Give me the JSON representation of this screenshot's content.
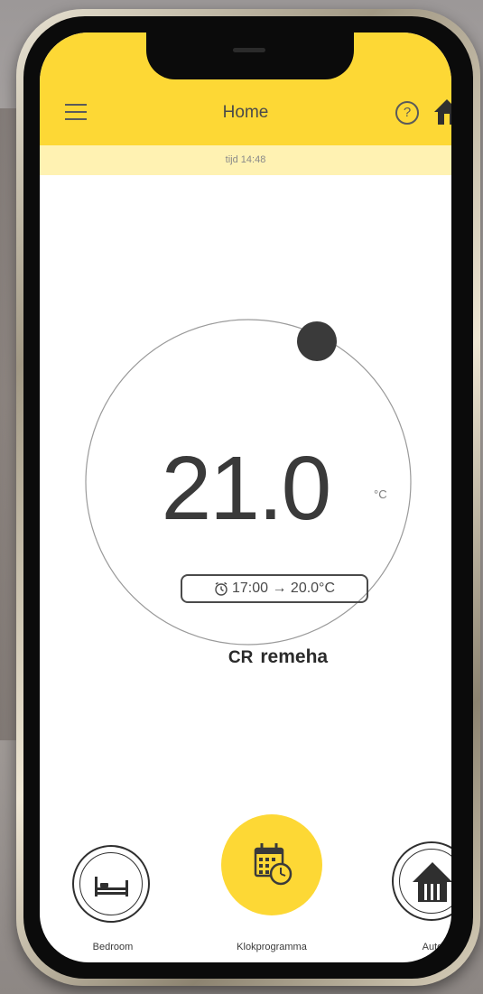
{
  "header": {
    "title": "Home",
    "menu_icon": "hamburger-menu-icon",
    "help_icon": "question-mark-icon",
    "help_glyph": "?",
    "home_icon": "house-icon",
    "color": "#fdd835"
  },
  "status": {
    "text": "tijd 14:48"
  },
  "thermostat": {
    "temperature": "21.0",
    "unit": "°C",
    "next_schedule": "17:00 → 20.0°C",
    "clock_icon": "alarm-clock-icon"
  },
  "brand": {
    "mark": "CR",
    "name": "remeha"
  },
  "bottom_nav": [
    {
      "label": "Bedroom",
      "icon": "bed-icon"
    },
    {
      "label": "Klokprogramma",
      "icon": "calendar-clock-icon"
    },
    {
      "label": "Auto",
      "icon": "house-icon"
    }
  ],
  "colors": {
    "accent": "#fdd835",
    "accent_light": "#fff2b2",
    "dial": "#3a3a3a"
  }
}
